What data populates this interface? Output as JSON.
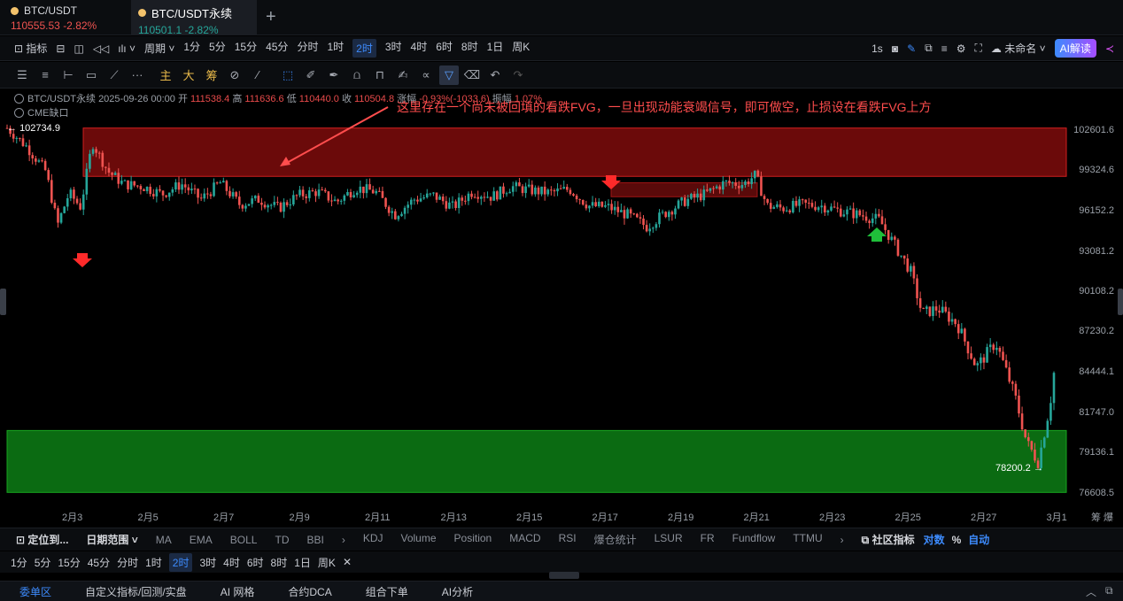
{
  "tabs": [
    {
      "name": "BTC/USDT",
      "price": "110555.53",
      "change": "-2.82%",
      "active": false
    },
    {
      "name": "BTC/USDT永续",
      "price": "110501.1",
      "change": "-2.82%",
      "active": true
    }
  ],
  "toolbar": {
    "indicators_label": "指标",
    "period_label": "周期",
    "intervals": [
      "1分",
      "5分",
      "15分",
      "45分",
      "分时",
      "1时",
      "2时",
      "3时",
      "4时",
      "6时",
      "8时",
      "1日",
      "周K"
    ],
    "active_interval": "2时",
    "refresh": "1s",
    "untitled": "未命名",
    "ai_button": "AI解读"
  },
  "draw_tools": {
    "main": "主",
    "big": "大",
    "chip": "筹"
  },
  "info": {
    "symbol": "BTC/USDT永续",
    "datetime": "2025-09-26 00:00",
    "open_label": "开",
    "open": "111538.4",
    "high_label": "高",
    "high": "111636.6",
    "low_label": "低",
    "low": "110440.0",
    "close_label": "收",
    "close": "110504.8",
    "change_label": "涨幅",
    "change": "-0.93%(-1033.6)",
    "amp_label": "振幅",
    "amp": "1.07%",
    "cme": "CME缺口"
  },
  "annotation": "这里存在一个尚未被回填的看跌FVG，一旦出现动能衰竭信号，即可做空，止损设在看跌FVG上方",
  "markers": {
    "high_label": "102734.9",
    "low_label": "78200.2"
  },
  "price_axis": [
    "102601.6",
    "99324.6",
    "96152.2",
    "93081.2",
    "90108.2",
    "87230.2",
    "84444.1",
    "81747.0",
    "79136.1",
    "76608.5"
  ],
  "date_axis": [
    "2月3",
    "2月5",
    "2月7",
    "2月9",
    "2月11",
    "2月13",
    "2月15",
    "2月17",
    "2月19",
    "2月21",
    "2月23",
    "2月25",
    "2月27",
    "3月1"
  ],
  "date_axis_right": "筹 爆",
  "indicator_bar": {
    "locate": "定位到...",
    "range": "日期范围",
    "main_inds": [
      "MA",
      "EMA",
      "BOLL",
      "TD",
      "BBI"
    ],
    "sub_inds": [
      "KDJ",
      "Volume",
      "Position",
      "MACD",
      "RSI",
      "爆仓统计",
      "LSUR",
      "FR",
      "Fundflow",
      "TTMU"
    ],
    "community": "社区指标",
    "log": "对数",
    "pct": "%",
    "auto": "自动"
  },
  "bottom_tabs": [
    "委单区",
    "自定义指标/回测/实盘",
    "AI 网格",
    "合约DCA",
    "组合下单",
    "AI分析"
  ],
  "colors": {
    "up": "#26a69a",
    "down": "#ef5350",
    "accent": "#3d8bfd",
    "fvg_red": "#6b0a0a",
    "fvg_green": "#0b6b12"
  },
  "chart_data": {
    "type": "candlestick",
    "x_range": [
      "2月2",
      "3月1"
    ],
    "ylim": [
      76608.5,
      102601.6
    ],
    "zones": [
      {
        "name": "bearish FVG",
        "from_date": "2月2",
        "to_date": "3月1",
        "low": 98800,
        "high": 102700,
        "color": "red"
      },
      {
        "name": "demand",
        "from_date": "2月2",
        "to_date": "3月1",
        "low": 76700,
        "high": 80600,
        "color": "green"
      }
    ],
    "close_path": [
      [
        "2月2",
        102700
      ],
      [
        "2月2.5",
        101200
      ],
      [
        "2月3",
        99200
      ],
      [
        "2月3.3",
        95000
      ],
      [
        "2月3.6",
        97500
      ],
      [
        "2月3.9",
        96400
      ],
      [
        "2月4.2",
        101500
      ],
      [
        "2月4.6",
        99200
      ],
      [
        "2月5",
        98200
      ],
      [
        "2月5.5",
        98000
      ],
      [
        "2月6",
        97400
      ],
      [
        "2月6.5",
        98200
      ],
      [
        "2月7",
        97000
      ],
      [
        "2月7.5",
        98300
      ],
      [
        "2月8",
        96600
      ],
      [
        "2月8.5",
        97000
      ],
      [
        "2月9",
        96300
      ],
      [
        "2月9.5",
        97300
      ],
      [
        "2月10",
        97600
      ],
      [
        "2月10.5",
        96800
      ],
      [
        "2月11",
        97900
      ],
      [
        "2月11.5",
        97600
      ],
      [
        "2月12",
        95800
      ],
      [
        "2月12.5",
        97000
      ],
      [
        "2月13",
        97300
      ],
      [
        "2月13.5",
        96400
      ],
      [
        "2月14",
        97600
      ],
      [
        "2月14.5",
        97200
      ],
      [
        "2月15",
        98000
      ],
      [
        "2月15.5",
        97700
      ],
      [
        "2月16",
        97500
      ],
      [
        "2月16.5",
        97800
      ],
      [
        "2月17",
        96500
      ],
      [
        "2月17.5",
        96400
      ],
      [
        "2月18",
        95800
      ],
      [
        "2月18.5",
        94900
      ],
      [
        "2月19",
        96000
      ],
      [
        "2月19.5",
        96900
      ],
      [
        "2月20",
        97400
      ],
      [
        "2月20.5",
        98300
      ],
      [
        "2月21",
        98200
      ],
      [
        "2月21.3",
        98900
      ],
      [
        "2月21.6",
        96500
      ],
      [
        "2月22",
        96300
      ],
      [
        "2月22.5",
        96600
      ],
      [
        "2月23",
        96500
      ],
      [
        "2月23.5",
        96100
      ],
      [
        "2月24",
        95800
      ],
      [
        "2月24.5",
        95400
      ],
      [
        "2月25",
        93000
      ],
      [
        "2月25.3",
        91600
      ],
      [
        "2月25.6",
        88500
      ],
      [
        "2月26",
        88900
      ],
      [
        "2月26.5",
        87800
      ],
      [
        "2月27",
        84800
      ],
      [
        "2月27.5",
        86500
      ],
      [
        "2月27.8",
        84300
      ],
      [
        "2月28",
        82800
      ],
      [
        "2月28.3",
        79800
      ],
      [
        "2月28.6",
        78600
      ],
      [
        "2月28.9",
        82300
      ],
      [
        "3月1",
        84400
      ]
    ]
  }
}
